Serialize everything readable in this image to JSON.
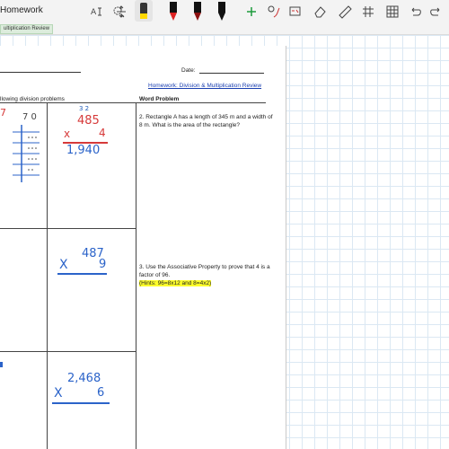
{
  "app": {
    "title": "Homework"
  },
  "toolbar": {
    "icons": [
      "text-select-icon",
      "lasso-add-icon",
      "insert-space-icon",
      "highlighter-icon",
      "pen-red-icon",
      "pen-dark-red-icon",
      "pen-black-icon",
      "add-pen-icon",
      "ink-to-shape-icon",
      "ink-to-math-icon",
      "eraser-icon",
      "ruler-icon",
      "grid-icon",
      "undo-icon",
      "redo-icon"
    ],
    "colors": {
      "highlighter": "#ffd800",
      "pen_red": "#d22",
      "pen_dark_red": "#8b1010",
      "pen_black": "#111"
    }
  },
  "tab": {
    "label": "ultiplication Review"
  },
  "worksheet": {
    "date_label": "Date:",
    "title": "Homework: Division & Multiplication Review",
    "col_left_header": "llowing division problems",
    "col_right_header": "Word Problem",
    "problem2": "2. Rectangle A has a length of 345 m and a width of 8 m. What is the area of the rectangle?",
    "problem3": "3. Use the Associative Property to prove that 4 is a factor of 96.",
    "problem3_hint": "(Hints: 96=8x12 and 8=4x2)"
  },
  "ink": {
    "red_7": "7",
    "top_carry": "3 2",
    "top_num": "485",
    "top_x": "x",
    "top_mult": "4",
    "top_ans": "1,940",
    "mid_num": "487",
    "mid_x": "X",
    "mid_mult": "9",
    "bot_num": "2,468",
    "bot_x": "X",
    "bot_mult": "6",
    "div_num": "7 0"
  }
}
